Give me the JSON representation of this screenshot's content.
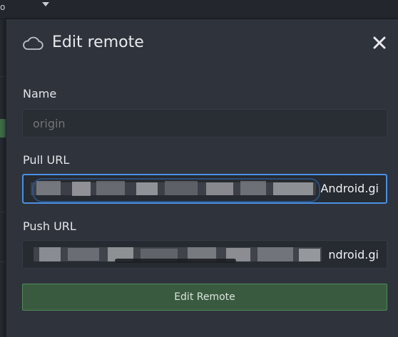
{
  "background": {
    "topbar_text": "o"
  },
  "dialog": {
    "title": "Edit remote",
    "icon": "cloud-icon",
    "close_icon": "close-icon"
  },
  "form": {
    "name": {
      "label": "Name",
      "placeholder": "origin"
    },
    "pull_url": {
      "label": "Pull URL",
      "visible_tail": "Android.gi"
    },
    "push_url": {
      "label": "Push URL",
      "visible_tail": "ndroid.gi"
    },
    "submit_label": "Edit Remote"
  },
  "colors": {
    "accent_focus": "#4a90e2",
    "submit_bg": "#3a5a40",
    "submit_border": "#4b8a55",
    "panel_bg": "#2f333c"
  }
}
